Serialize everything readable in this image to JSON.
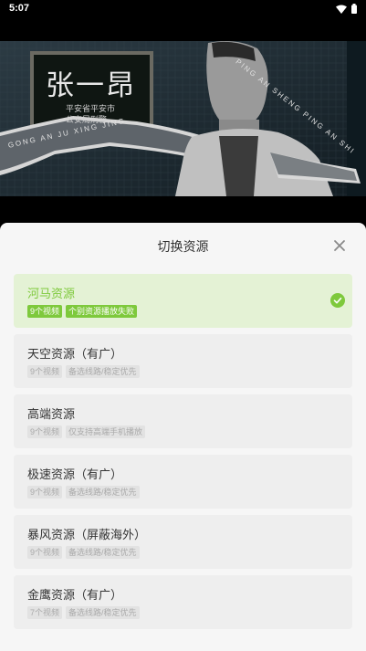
{
  "status_bar": {
    "time": "5:07"
  },
  "video": {
    "poster_title": "张一昂",
    "poster_sub1": "平安省平安市",
    "poster_sub2": "公安局刑警",
    "ribbon_left": "GONG AN JU XING JING",
    "ribbon_right": "PING AN SHENG PING AN SHI"
  },
  "sheet": {
    "title": "切换资源",
    "sources": [
      {
        "name": "河马资源",
        "tag1": "9个视频",
        "tag2": "个别资源播放失败",
        "selected": true
      },
      {
        "name": "天空资源（有广）",
        "tag1": "9个视频",
        "tag2": "备选线路/稳定优先"
      },
      {
        "name": "高端资源",
        "tag1": "9个视频",
        "tag2": "仅支持高端手机播放"
      },
      {
        "name": "极速资源（有广）",
        "tag1": "9个视频",
        "tag2": "备选线路/稳定优先"
      },
      {
        "name": "暴风资源（屏蔽海外）",
        "tag1": "9个视频",
        "tag2": "备选线路/稳定优先"
      },
      {
        "name": "金鹰资源（有广）",
        "tag1": "7个视频",
        "tag2": "备选线路/稳定优先"
      }
    ]
  },
  "colors": {
    "accent": "#7ec93c",
    "selected_bg": "#e4f2d5",
    "item_bg": "#eeeeee",
    "sheet_bg": "#f6f6f6"
  },
  "icons": {
    "close": "close-icon",
    "check": "check-circle-icon",
    "wifi": "wifi-icon",
    "battery": "battery-icon"
  }
}
